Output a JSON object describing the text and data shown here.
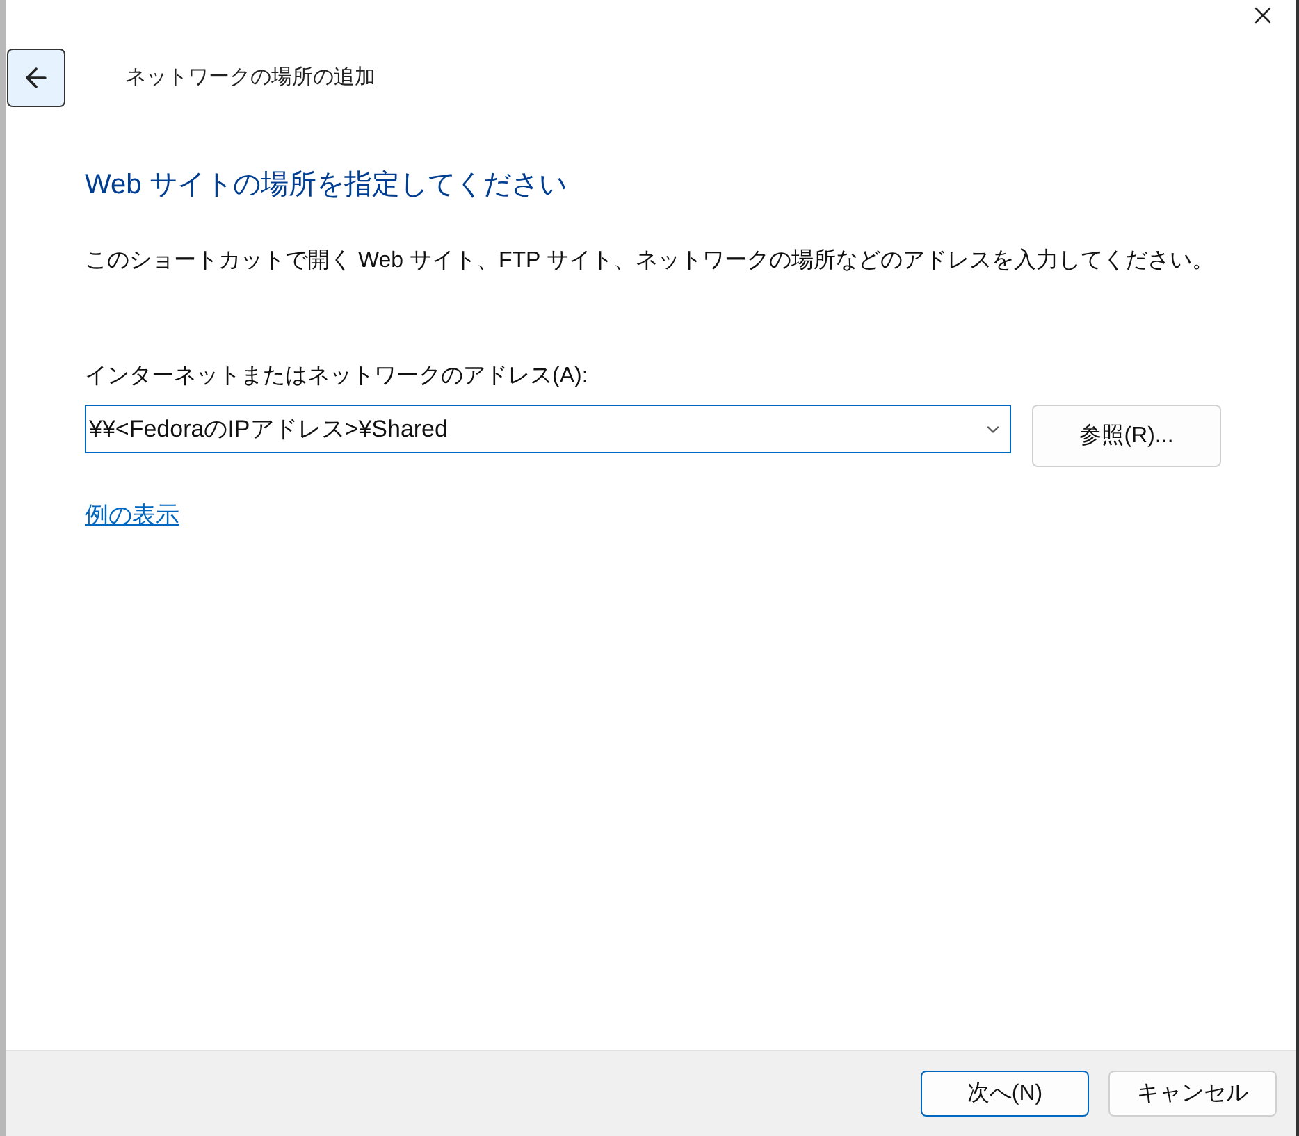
{
  "window": {
    "title": "ネットワークの場所の追加"
  },
  "heading": "Web サイトの場所を指定してください",
  "description": "このショートカットで開く Web サイト、FTP サイト、ネットワークの場所などのアドレスを入力してください。",
  "address": {
    "label": "インターネットまたはネットワークのアドレス(A):",
    "value": "¥¥<FedoraのIPアドレス>¥Shared"
  },
  "browse_button": "参照(R)...",
  "examples_link": "例の表示",
  "buttons": [
    {
      "label": "次へ(N)",
      "kind": "default"
    },
    {
      "label": "キャンセル",
      "kind": "normal"
    }
  ]
}
